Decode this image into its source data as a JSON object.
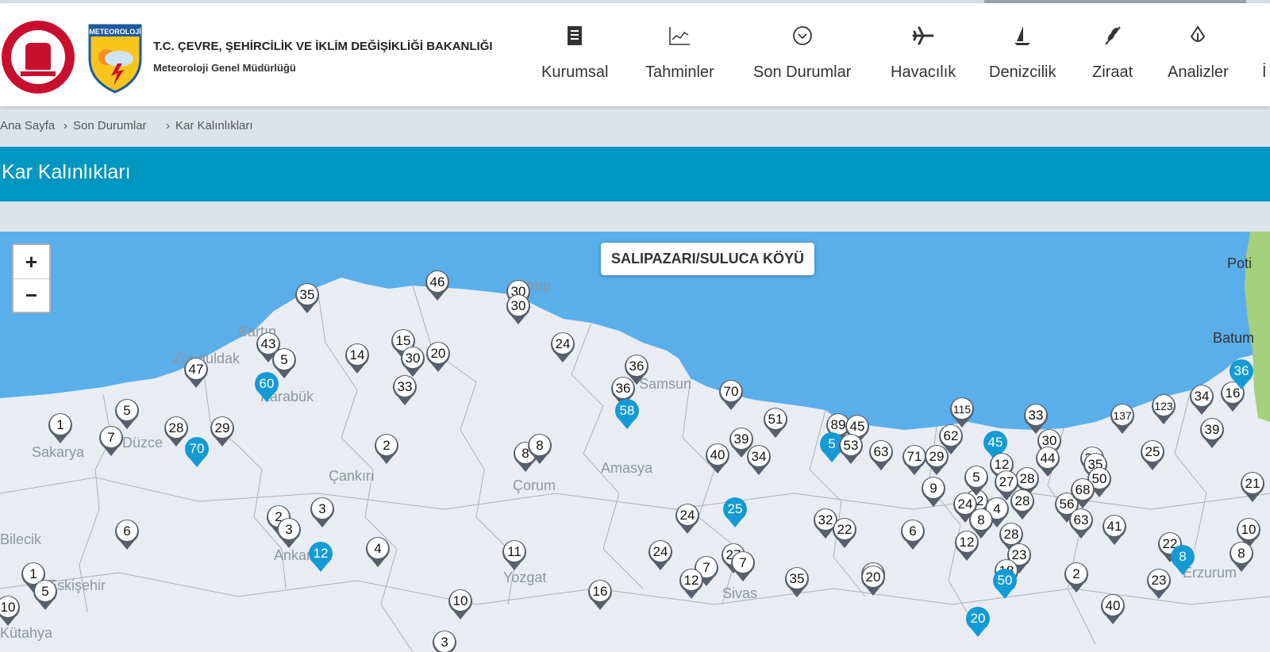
{
  "ministry_title": "T.C. ÇEVRE, ŞEHİRCİLİK VE İKLİM DEĞİŞİKLİĞİ BAKANLIĞI",
  "department": "Meteoroloji Genel Müdürlüğü",
  "logo_text": "METEOROLOJİ",
  "nav": [
    {
      "label": "Kurumsal",
      "icon": "document-icon"
    },
    {
      "label": "Tahminler",
      "icon": "chart-icon"
    },
    {
      "label": "Son Durumlar",
      "icon": "clock-icon"
    },
    {
      "label": "Havacılık",
      "icon": "airplane-icon"
    },
    {
      "label": "Denizcilik",
      "icon": "sailboat-icon"
    },
    {
      "label": "Ziraat",
      "icon": "wheat-icon"
    },
    {
      "label": "Analizler",
      "icon": "analysis-icon"
    },
    {
      "label": "İ",
      "icon": ""
    }
  ],
  "breadcrumb": [
    "Ana Sayfa",
    "›",
    "Son Durumlar",
    "›",
    "Kar Kalınlıkları"
  ],
  "page_title": "Kar Kalınlıkları",
  "map": {
    "zoom_in": "+",
    "zoom_out": "−",
    "tooltip": "SALIPAZARI/SULUCA KÖYÜ",
    "labels": [
      "Sinop",
      "Samsun",
      "Çankırı",
      "Çorum",
      "Amasya",
      "Sakarya",
      "Düzce",
      "Zonguldak",
      "Karabük",
      "Bilecik",
      "Eskişehir",
      "Kütahya",
      "Yozgat",
      "Sivas",
      "Poti",
      "Batum",
      "Bartın",
      "Ankara",
      "Erzurum"
    ],
    "colors": {
      "sea": "#5aaeea",
      "land": "#e9edf1",
      "forest": "#a5d07e",
      "marker_default": "#565f6b",
      "marker_highlight": "#149ad4"
    },
    "markers": [
      {
        "value": "46",
        "type": "default"
      },
      {
        "value": "35",
        "type": "default"
      },
      {
        "value": "30",
        "type": "default"
      },
      {
        "value": "30",
        "type": "default"
      },
      {
        "value": "43",
        "type": "default"
      },
      {
        "value": "5",
        "type": "default"
      },
      {
        "value": "47",
        "type": "default"
      },
      {
        "value": "60",
        "type": "highlight"
      },
      {
        "value": "14",
        "type": "default"
      },
      {
        "value": "15",
        "type": "default"
      },
      {
        "value": "30",
        "type": "default"
      },
      {
        "value": "20",
        "type": "default"
      },
      {
        "value": "33",
        "type": "default"
      },
      {
        "value": "24",
        "type": "default"
      },
      {
        "value": "36",
        "type": "default"
      },
      {
        "value": "36",
        "type": "default"
      },
      {
        "value": "58",
        "type": "highlight"
      },
      {
        "value": "70",
        "type": "default"
      },
      {
        "value": "51",
        "type": "default"
      },
      {
        "value": "5",
        "type": "default"
      },
      {
        "value": "1",
        "type": "default"
      },
      {
        "value": "7",
        "type": "default"
      },
      {
        "value": "28",
        "type": "default"
      },
      {
        "value": "29",
        "type": "default"
      },
      {
        "value": "70",
        "type": "highlight"
      },
      {
        "value": "2",
        "type": "default"
      },
      {
        "value": "8",
        "type": "default"
      },
      {
        "value": "8",
        "type": "default"
      },
      {
        "value": "39",
        "type": "default"
      },
      {
        "value": "40",
        "type": "default"
      },
      {
        "value": "34",
        "type": "default"
      },
      {
        "value": "89",
        "type": "default"
      },
      {
        "value": "45",
        "type": "default"
      },
      {
        "value": "5",
        "type": "highlight"
      },
      {
        "value": "53",
        "type": "default"
      },
      {
        "value": "63",
        "type": "default"
      },
      {
        "value": "71",
        "type": "default"
      },
      {
        "value": "29",
        "type": "default"
      },
      {
        "value": "115",
        "type": "default"
      },
      {
        "value": "62",
        "type": "default"
      },
      {
        "value": "45",
        "type": "highlight"
      },
      {
        "value": "33",
        "type": "default"
      },
      {
        "value": "30",
        "type": "default"
      },
      {
        "value": "44",
        "type": "default"
      },
      {
        "value": "137",
        "type": "default"
      },
      {
        "value": "123",
        "type": "default"
      },
      {
        "value": "34",
        "type": "default"
      },
      {
        "value": "16",
        "type": "default"
      },
      {
        "value": "35",
        "type": "default"
      },
      {
        "value": "36",
        "type": "highlight"
      },
      {
        "value": "39",
        "type": "default"
      },
      {
        "value": "25",
        "type": "default"
      },
      {
        "value": "35",
        "type": "default"
      },
      {
        "value": "50",
        "type": "default"
      },
      {
        "value": "21",
        "type": "default"
      },
      {
        "value": "28",
        "type": "default"
      },
      {
        "value": "3",
        "type": "default"
      },
      {
        "value": "2",
        "type": "default"
      },
      {
        "value": "3",
        "type": "default"
      },
      {
        "value": "6",
        "type": "default"
      },
      {
        "value": "12",
        "type": "highlight"
      },
      {
        "value": "4",
        "type": "default"
      },
      {
        "value": "24",
        "type": "default"
      },
      {
        "value": "25",
        "type": "highlight"
      },
      {
        "value": "32",
        "type": "default"
      },
      {
        "value": "22",
        "type": "default"
      },
      {
        "value": "6",
        "type": "default"
      },
      {
        "value": "12",
        "type": "default"
      },
      {
        "value": "9",
        "type": "default"
      },
      {
        "value": "5",
        "type": "default"
      },
      {
        "value": "12",
        "type": "default"
      },
      {
        "value": "27",
        "type": "default"
      },
      {
        "value": "28",
        "type": "default"
      },
      {
        "value": "24",
        "type": "default"
      },
      {
        "value": "4",
        "type": "default"
      },
      {
        "value": "8",
        "type": "default"
      },
      {
        "value": "28",
        "type": "default"
      },
      {
        "value": "56",
        "type": "default"
      },
      {
        "value": "68",
        "type": "default"
      },
      {
        "value": "63",
        "type": "default"
      },
      {
        "value": "41",
        "type": "default"
      },
      {
        "value": "22",
        "type": "default"
      },
      {
        "value": "12",
        "type": "default"
      },
      {
        "value": "23",
        "type": "default"
      },
      {
        "value": "18",
        "type": "default"
      },
      {
        "value": "50",
        "type": "highlight"
      },
      {
        "value": "2",
        "type": "default"
      },
      {
        "value": "20",
        "type": "default"
      },
      {
        "value": "8",
        "type": "highlight"
      },
      {
        "value": "10",
        "type": "default"
      },
      {
        "value": "8",
        "type": "default"
      },
      {
        "value": "23",
        "type": "default"
      },
      {
        "value": "11",
        "type": "default"
      },
      {
        "value": "24",
        "type": "default"
      },
      {
        "value": "27",
        "type": "default"
      },
      {
        "value": "7",
        "type": "default"
      },
      {
        "value": "7",
        "type": "default"
      },
      {
        "value": "12",
        "type": "default"
      },
      {
        "value": "35",
        "type": "default"
      },
      {
        "value": "20",
        "type": "default"
      },
      {
        "value": "16",
        "type": "default"
      },
      {
        "value": "10",
        "type": "default"
      },
      {
        "value": "40",
        "type": "default"
      },
      {
        "value": "20",
        "type": "highlight"
      },
      {
        "value": "1",
        "type": "default"
      },
      {
        "value": "5",
        "type": "default"
      },
      {
        "value": "10",
        "type": "default"
      },
      {
        "value": "3",
        "type": "default"
      }
    ]
  }
}
